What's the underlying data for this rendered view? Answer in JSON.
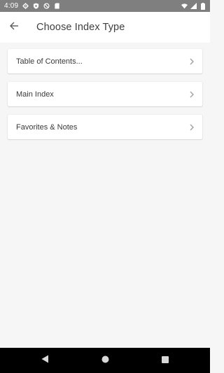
{
  "status_bar": {
    "time": "4:09",
    "left_icons": [
      "gear-icon",
      "shield-icon",
      "circle-slash-icon",
      "sd-card-icon"
    ],
    "right_icons": [
      "wifi-icon",
      "signal-icon",
      "battery-icon"
    ],
    "background": "#7f7f7f"
  },
  "app_bar": {
    "title": "Choose Index Type",
    "back_icon": "arrow-left-icon"
  },
  "list": {
    "items": [
      {
        "label": "Table of Contents..."
      },
      {
        "label": "Main Index"
      },
      {
        "label": "Favorites & Notes"
      }
    ],
    "chevron_icon": "chevron-right-icon"
  },
  "nav_bar": {
    "buttons": [
      "back-triangle-icon",
      "home-circle-icon",
      "recents-square-icon"
    ]
  },
  "colors": {
    "page_background": "#f6f6f6",
    "card_background": "#ffffff",
    "text": "#3a3a3a",
    "chevron": "#9e9e9e"
  }
}
